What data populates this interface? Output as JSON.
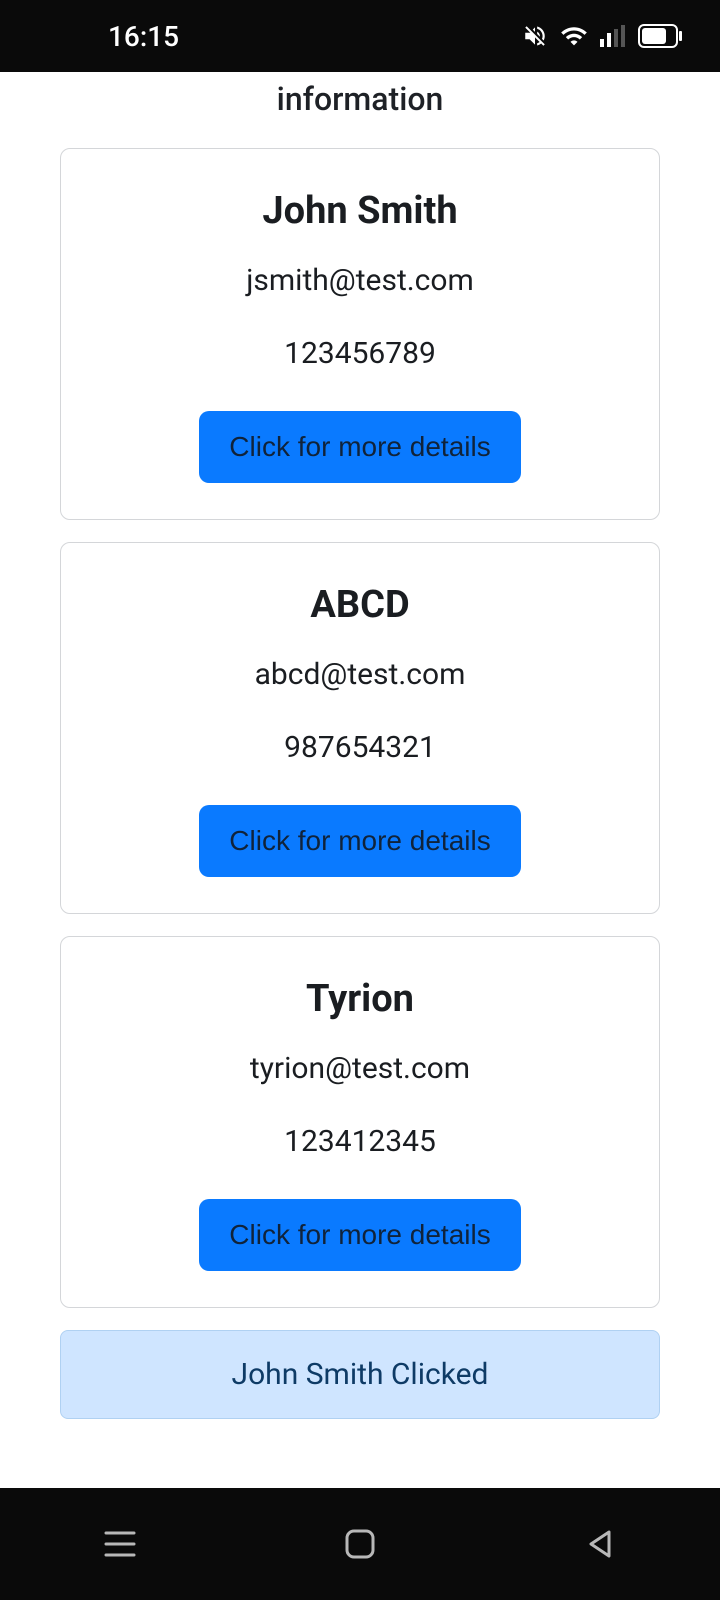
{
  "status": {
    "time": "16:15"
  },
  "header": {
    "title": "information"
  },
  "contacts": [
    {
      "name": "John Smith",
      "email": "jsmith@test.com",
      "phone": "123456789",
      "button_label": "Click for more details"
    },
    {
      "name": "ABCD",
      "email": "abcd@test.com",
      "phone": "987654321",
      "button_label": "Click for more details"
    },
    {
      "name": "Tyrion",
      "email": "tyrion@test.com",
      "phone": "123412345",
      "button_label": "Click for more details"
    }
  ],
  "alert": {
    "message": "John Smith Clicked"
  }
}
